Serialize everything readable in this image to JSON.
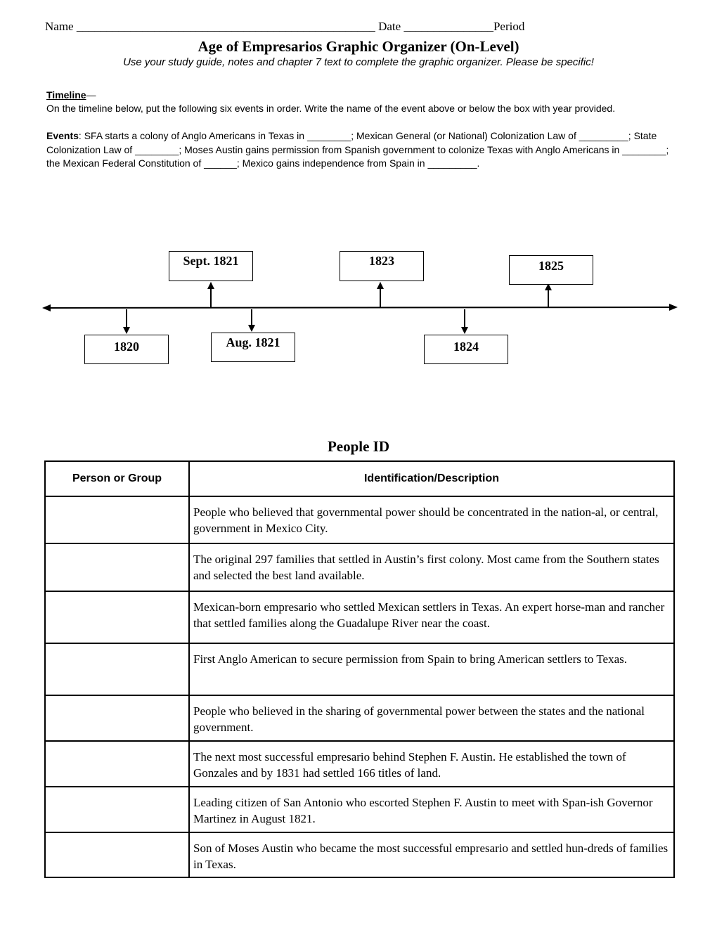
{
  "header": {
    "name_label": "Name",
    "name_blank": "__________________________________________________",
    "date_label": "Date",
    "date_blank": "_______________",
    "period_label": "Period"
  },
  "title": "Age of Empresarios Graphic Organizer (On-Level)",
  "subtitle": "Use your study guide, notes and chapter 7 text to complete the graphic organizer. Please be specific!",
  "timeline_section": {
    "heading": "Timeline",
    "heading_dash": "—",
    "instructions": "On the timeline below, put the following six events in order. Write the name of the event above or below the box with year provided.",
    "events_label": "Events",
    "events_text": ":  SFA starts a colony of Anglo Americans in Texas in ________; Mexican General (or National) Colonization Law of _________; State Colonization Law of ________; Moses Austin gains permission from Spanish government to colonize Texas with Anglo Americans in ________; the Mexican Federal Constitution of ______; Mexico gains independence from Spain in _________."
  },
  "timeline_boxes": [
    {
      "label": "1820",
      "position": "below"
    },
    {
      "label": "Aug. 1821",
      "position": "below"
    },
    {
      "label": "Sept. 1821",
      "position": "above"
    },
    {
      "label": "1823",
      "position": "above"
    },
    {
      "label": "1824",
      "position": "below"
    },
    {
      "label": "1825",
      "position": "above"
    }
  ],
  "people_id": {
    "title": "People ID",
    "columns": [
      "Person or Group",
      "Identification/Description"
    ],
    "rows": [
      {
        "person": "",
        "description": "People who believed that governmental power should be concentrated in the nation-al, or central, government in Mexico City."
      },
      {
        "person": "",
        "description": "The original 297 families that settled in Austin’s first colony. Most came from the Southern states and selected the best land available."
      },
      {
        "person": "",
        "description": "Mexican-born empresario who settled Mexican settlers in Texas. An expert horse-man and rancher that settled families along the Guadalupe River near the coast."
      },
      {
        "person": "",
        "description": "First Anglo American to secure permission from Spain to bring American settlers to Texas."
      },
      {
        "person": "",
        "description": "People who believed in the sharing of governmental power between the states and the national government."
      },
      {
        "person": "",
        "description": "The next most successful empresario behind Stephen F. Austin. He established the town of Gonzales and by 1831 had settled 166 titles of land."
      },
      {
        "person": "",
        "description": "Leading citizen of San Antonio who escorted Stephen F. Austin to meet with Span-ish Governor Martinez in August 1821."
      },
      {
        "person": "",
        "description": "Son of Moses Austin who became the most successful empresario and settled hun-dreds of families in Texas."
      }
    ]
  }
}
